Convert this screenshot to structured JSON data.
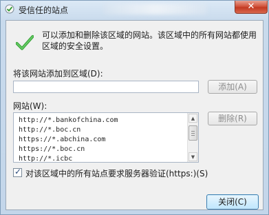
{
  "window": {
    "title": "受信任的站点",
    "close_glyph": "✕"
  },
  "info": {
    "text": "可以添加和删除该区域的网站。该区域中的所有网站都使用区域的安全设置。"
  },
  "add_site": {
    "label": "将该网站添加到区域(D):",
    "input_value": "",
    "button_label": "添加(A)"
  },
  "sites": {
    "label": "网站(W):",
    "items": [
      "http://*.bankofchina.com",
      "http://*.boc.cn",
      "https://*.abchina.com",
      "https://*.boc.cn",
      "http://*.icbc"
    ],
    "remove_label": "删除(R)"
  },
  "require_https": {
    "checked": true,
    "check_glyph": "✓",
    "label": "对该区域中的所有站点要求服务器验证(https:)(S)"
  },
  "footer": {
    "close_label": "关闭(C)"
  }
}
